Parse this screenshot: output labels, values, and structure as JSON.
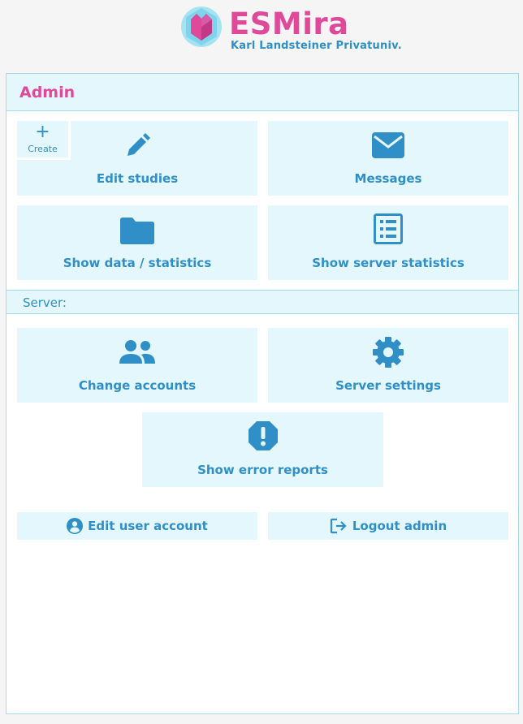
{
  "brand": {
    "title": "ESMira",
    "subtitle": "Karl Landsteiner Privatuniv."
  },
  "panel": {
    "title": "Admin"
  },
  "tiles": {
    "create_label": "Create",
    "create_icon": "plus-icon",
    "edit_studies": {
      "label": "Edit studies",
      "icon": "pencil-icon"
    },
    "messages": {
      "label": "Messages",
      "icon": "envelope-icon"
    },
    "show_data": {
      "label": "Show data / statistics",
      "icon": "folder-icon"
    },
    "server_stats": {
      "label": "Show server statistics",
      "icon": "list-icon"
    },
    "change_accounts": {
      "label": "Change accounts",
      "icon": "users-icon"
    },
    "server_settings": {
      "label": "Server settings",
      "icon": "gear-icon"
    },
    "error_reports": {
      "label": "Show error reports",
      "icon": "exclamation-octagon-icon"
    }
  },
  "server_section": {
    "label": "Server:"
  },
  "account_buttons": {
    "edit_user": {
      "label": "Edit user account",
      "icon": "user-circle-icon"
    },
    "logout": {
      "label": "Logout admin",
      "icon": "logout-icon"
    }
  },
  "colors": {
    "brand_pink": "#e0489a",
    "accent_blue": "#2f8fc6",
    "tile_bg": "#e3f7fd",
    "border": "#a8d9ec"
  }
}
